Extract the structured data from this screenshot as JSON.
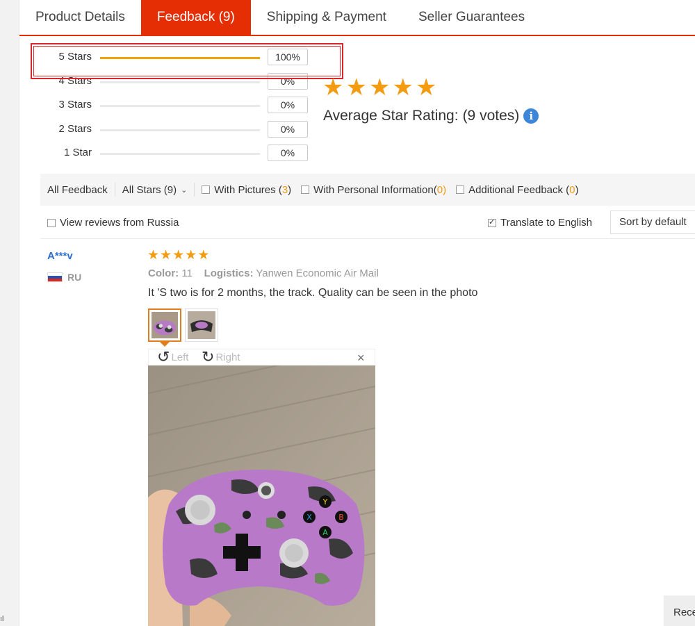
{
  "tabs": [
    {
      "label": "Product Details",
      "active": false
    },
    {
      "label": "Feedback (9)",
      "active": true
    },
    {
      "label": "Shipping & Payment",
      "active": false
    },
    {
      "label": "Seller Guarantees",
      "active": false
    }
  ],
  "histogram": [
    {
      "label": "5 Stars",
      "percent": "100%",
      "fill": 1.0
    },
    {
      "label": "4 Stars",
      "percent": "0%",
      "fill": 0
    },
    {
      "label": "3 Stars",
      "percent": "0%",
      "fill": 0
    },
    {
      "label": "2 Stars",
      "percent": "0%",
      "fill": 0
    },
    {
      "label": "1 Star",
      "percent": "0%",
      "fill": 0
    }
  ],
  "summary": {
    "stars": 5,
    "label": "Average Star Rating:",
    "votes": "(9 votes)",
    "info_icon": "info-icon"
  },
  "filters": {
    "all_feedback": "All Feedback",
    "all_stars": "All Stars (9)",
    "with_pictures": "With Pictures (",
    "with_pictures_count": "3",
    "with_personal_info": "With Personal Information(",
    "with_personal_info_count": "0",
    "additional_feedback": "Additional Feedback (",
    "additional_feedback_count": "0",
    "close_paren": ")"
  },
  "options": {
    "view_russia": "View reviews from Russia",
    "translate": "Translate to English",
    "translate_checked": true,
    "sort": "Sort by default"
  },
  "review": {
    "author": "A***v",
    "country": "RU",
    "stars": 5,
    "color_label": "Color:",
    "color_value": "11",
    "logistics_label": "Logistics:",
    "logistics_value": "Yanwen Economic Air Mail",
    "text": "It 'S two is for 2 months, the track. Quality can be seen in the photo",
    "viewer": {
      "rotate_left": "Left",
      "rotate_right": "Right",
      "close": "×"
    }
  },
  "recent_button": "Rece",
  "gutter_mark": "ıl",
  "colors": {
    "accent": "#e62e04",
    "star": "#f39c12",
    "link": "#2c6fd1"
  }
}
